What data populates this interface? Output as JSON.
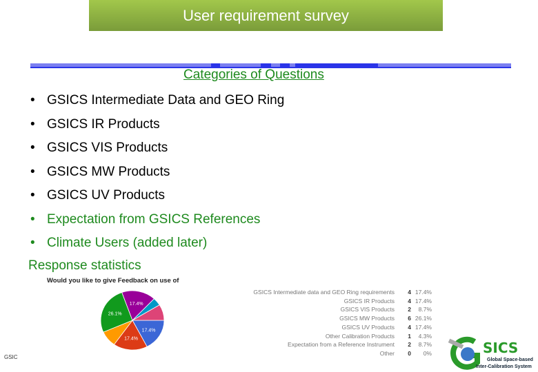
{
  "title": "User requirement survey",
  "heading": "Categories of Questions",
  "bullets": [
    {
      "text": "GSICS Intermediate Data and GEO Ring",
      "color": "#000000"
    },
    {
      "text": "GSICS IR Products",
      "color": "#000000"
    },
    {
      "text": "GSICS  VIS Products",
      "color": "#000000"
    },
    {
      "text": "GSICS MW Products",
      "color": "#000000"
    },
    {
      "text": "GSICS UV Products",
      "color": "#000000"
    },
    {
      "text": "Expectation from GSICS References",
      "color": "#1e8a1e"
    },
    {
      "text": "Climate Users (added later)",
      "color": "#1e8a1e"
    }
  ],
  "bullet_glyph": "•",
  "response_label": "Response statistics",
  "chart_data": {
    "type": "pie",
    "title": "Would you like to give Feedback on use of",
    "categories": [
      "GSICS Intermediate data and GEO Ring requirements",
      "GSICS IR Products",
      "GSICS VIS Products",
      "GSICS MW Products",
      "GSICS UV Products",
      "Other Calibration Products",
      "Expectation from a Reference Instrument",
      "Other"
    ],
    "counts": [
      4,
      4,
      2,
      6,
      4,
      1,
      2,
      0
    ],
    "percents": [
      "17.4%",
      "17.4%",
      "8.7%",
      "26.1%",
      "17.4%",
      "4.3%",
      "8.7%",
      "0%"
    ],
    "slices": [
      {
        "value": 17.4,
        "color": "#3b66d6",
        "label": "17.4%"
      },
      {
        "value": 17.4,
        "color": "#dc3b16",
        "label": "17.4%"
      },
      {
        "value": 8.7,
        "color": "#ff9a00",
        "label": ""
      },
      {
        "value": 26.1,
        "color": "#119a1d",
        "label": "26.1%"
      },
      {
        "value": 17.4,
        "color": "#990099",
        "label": "17.4%"
      },
      {
        "value": 4.3,
        "color": "#0099c6",
        "label": ""
      },
      {
        "value": 8.7,
        "color": "#dd4477",
        "label": ""
      }
    ]
  },
  "footer": "GSIC",
  "logo": {
    "letters": "SICS",
    "line1": "Global Space-based",
    "line2": "Inter-Calibration System"
  }
}
